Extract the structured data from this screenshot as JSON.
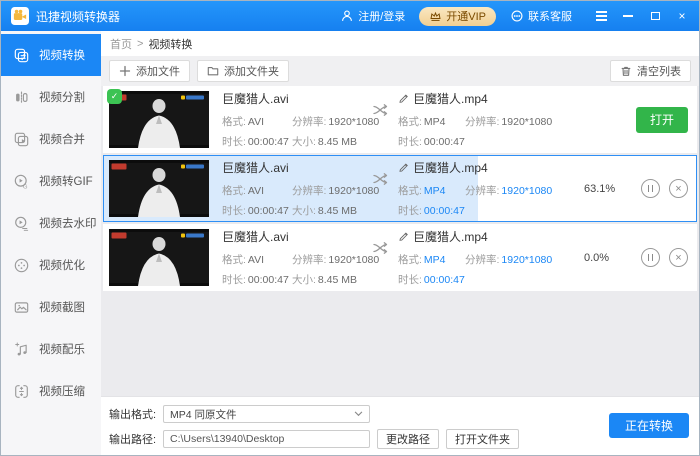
{
  "window": {
    "title": "迅捷视频转换器"
  },
  "titlebar": {
    "login": "注册/登录",
    "vip": "开通VIP",
    "support": "联系客服"
  },
  "sidebar": {
    "items": [
      {
        "label": "视频转换",
        "active": true
      },
      {
        "label": "视频分割"
      },
      {
        "label": "视频合并"
      },
      {
        "label": "视频转GIF"
      },
      {
        "label": "视频去水印"
      },
      {
        "label": "视频优化"
      },
      {
        "label": "视频截图"
      },
      {
        "label": "视频配乐"
      },
      {
        "label": "视频压缩"
      }
    ]
  },
  "breadcrumb": {
    "home": "首页",
    "separator": ">",
    "current": "视频转换"
  },
  "toolbar": {
    "add_file": "添加文件",
    "add_folder": "添加文件夹",
    "clear": "清空列表"
  },
  "labels": {
    "format": "格式:",
    "resolution": "分辨率:",
    "duration": "时长:",
    "size": "大小:"
  },
  "rows": [
    {
      "source": {
        "name": "巨魔猎人.avi",
        "format": "AVI",
        "resolution": "1920*1080",
        "duration": "00:00:47",
        "size": "8.45 MB"
      },
      "output": {
        "name": "巨魔猎人.mp4",
        "format": "MP4",
        "resolution": "1920*1080",
        "duration": "00:00:47"
      },
      "state": "completed",
      "open_label": "打开"
    },
    {
      "source": {
        "name": "巨魔猎人.avi",
        "format": "AVI",
        "resolution": "1920*1080",
        "duration": "00:00:47",
        "size": "8.45 MB"
      },
      "output": {
        "name": "巨魔猎人.mp4",
        "format": "MP4",
        "resolution": "1920*1080",
        "duration": "00:00:47"
      },
      "state": "converting",
      "selected": true,
      "progress": "63.1%"
    },
    {
      "source": {
        "name": "巨魔猎人.avi",
        "format": "AVI",
        "resolution": "1920*1080",
        "duration": "00:00:47",
        "size": "8.45 MB"
      },
      "output": {
        "name": "巨魔猎人.mp4",
        "format": "MP4",
        "resolution": "1920*1080",
        "duration": "00:00:47"
      },
      "state": "converting",
      "progress": "0.0%"
    }
  ],
  "footer": {
    "output_format_label": "输出格式:",
    "output_format_value": "MP4  同原文件",
    "output_path_label": "输出路径:",
    "output_path_value": "C:\\Users\\13940\\Desktop",
    "change_path": "更改路径",
    "open_folder": "打开文件夹",
    "convert": "正在转换"
  },
  "colors": {
    "accent": "#1b87f5",
    "success_green": "#32b54a",
    "vip_gold": "#f2cf92",
    "selected_fill": "#d9eafc",
    "sidebar_bg": "#f6f6f8"
  }
}
